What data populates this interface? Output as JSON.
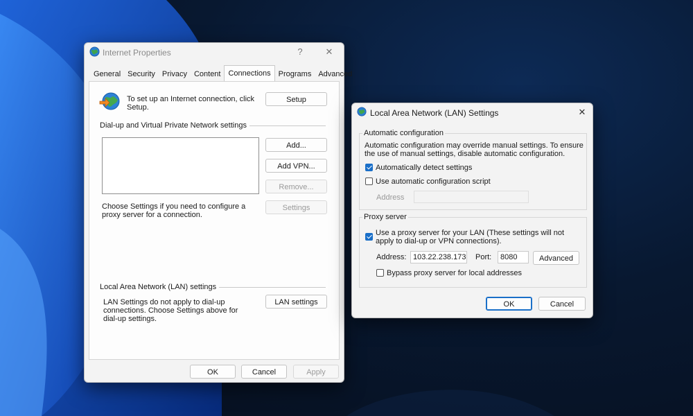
{
  "internet_properties": {
    "title": "Internet Properties",
    "help_glyph": "?",
    "close_glyph": "✕",
    "tabs": [
      "General",
      "Security",
      "Privacy",
      "Content",
      "Connections",
      "Programs",
      "Advanced"
    ],
    "active_tab": "Connections",
    "setup_text": "To set up an Internet connection, click Setup.",
    "setup_button": "Setup",
    "dialup_group_label": "Dial-up and Virtual Private Network settings",
    "add_button": "Add...",
    "add_vpn_button": "Add VPN...",
    "remove_button": "Remove...",
    "settings_button": "Settings",
    "proxy_hint": "Choose Settings if you need to configure a proxy server for a connection.",
    "lan_group_label": "Local Area Network (LAN) settings",
    "lan_note": "LAN Settings do not apply to dial-up connections. Choose Settings above for dial-up settings.",
    "lan_settings_button": "LAN settings",
    "ok_button": "OK",
    "cancel_button": "Cancel",
    "apply_button": "Apply"
  },
  "lan_dialog": {
    "title": "Local Area Network (LAN) Settings",
    "close_glyph": "✕",
    "auto_config_label": "Automatic configuration",
    "auto_config_desc": "Automatic configuration may override manual settings.  To ensure the use of manual settings, disable automatic configuration.",
    "auto_detect_label": "Automatically detect settings",
    "auto_detect_checked": true,
    "use_script_label": "Use automatic configuration script",
    "use_script_checked": false,
    "script_address_label": "Address",
    "script_address_value": "",
    "proxy_group_label": "Proxy server",
    "use_proxy_label": "Use a proxy server for your LAN (These settings will not apply to dial-up or VPN connections).",
    "use_proxy_checked": true,
    "address_label": "Address:",
    "address_value": "103.22.238.173",
    "port_label": "Port:",
    "port_value": "8080",
    "advanced_button": "Advanced",
    "bypass_label": "Bypass proxy server for local addresses",
    "bypass_checked": false,
    "ok_button": "OK",
    "cancel_button": "Cancel"
  },
  "colors": {
    "accent": "#1a6fc8",
    "window_bg": "#f3f3f3",
    "desktop_bg": "#081426"
  },
  "icons": {
    "window_icon": "internet-globe-icon",
    "setup_icon": "globe-with-arrow-icon"
  }
}
